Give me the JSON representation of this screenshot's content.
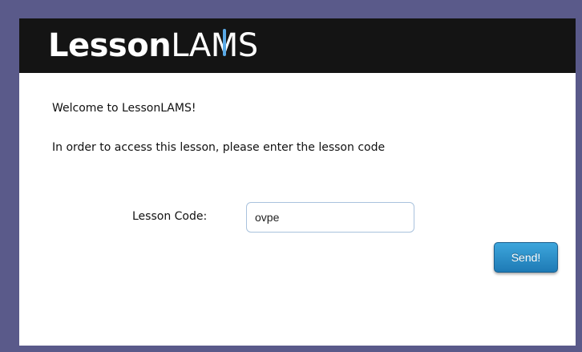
{
  "header": {
    "logo_bold": "Lesson",
    "logo_light_1": "LA",
    "logo_m": "M",
    "logo_light_2": "S"
  },
  "main": {
    "welcome": "Welcome to LessonLAMS!",
    "instruction": "In order to access this lesson, please enter the lesson code",
    "code_label": "Lesson Code:",
    "code_value": "ovpe",
    "send_label": "Send!"
  },
  "colors": {
    "page_border": "#5a5a8a",
    "header_bg": "#141414",
    "button_top": "#3da6dc",
    "button_bottom": "#1e7ab5",
    "logo_accent": "#5aa9e6"
  }
}
